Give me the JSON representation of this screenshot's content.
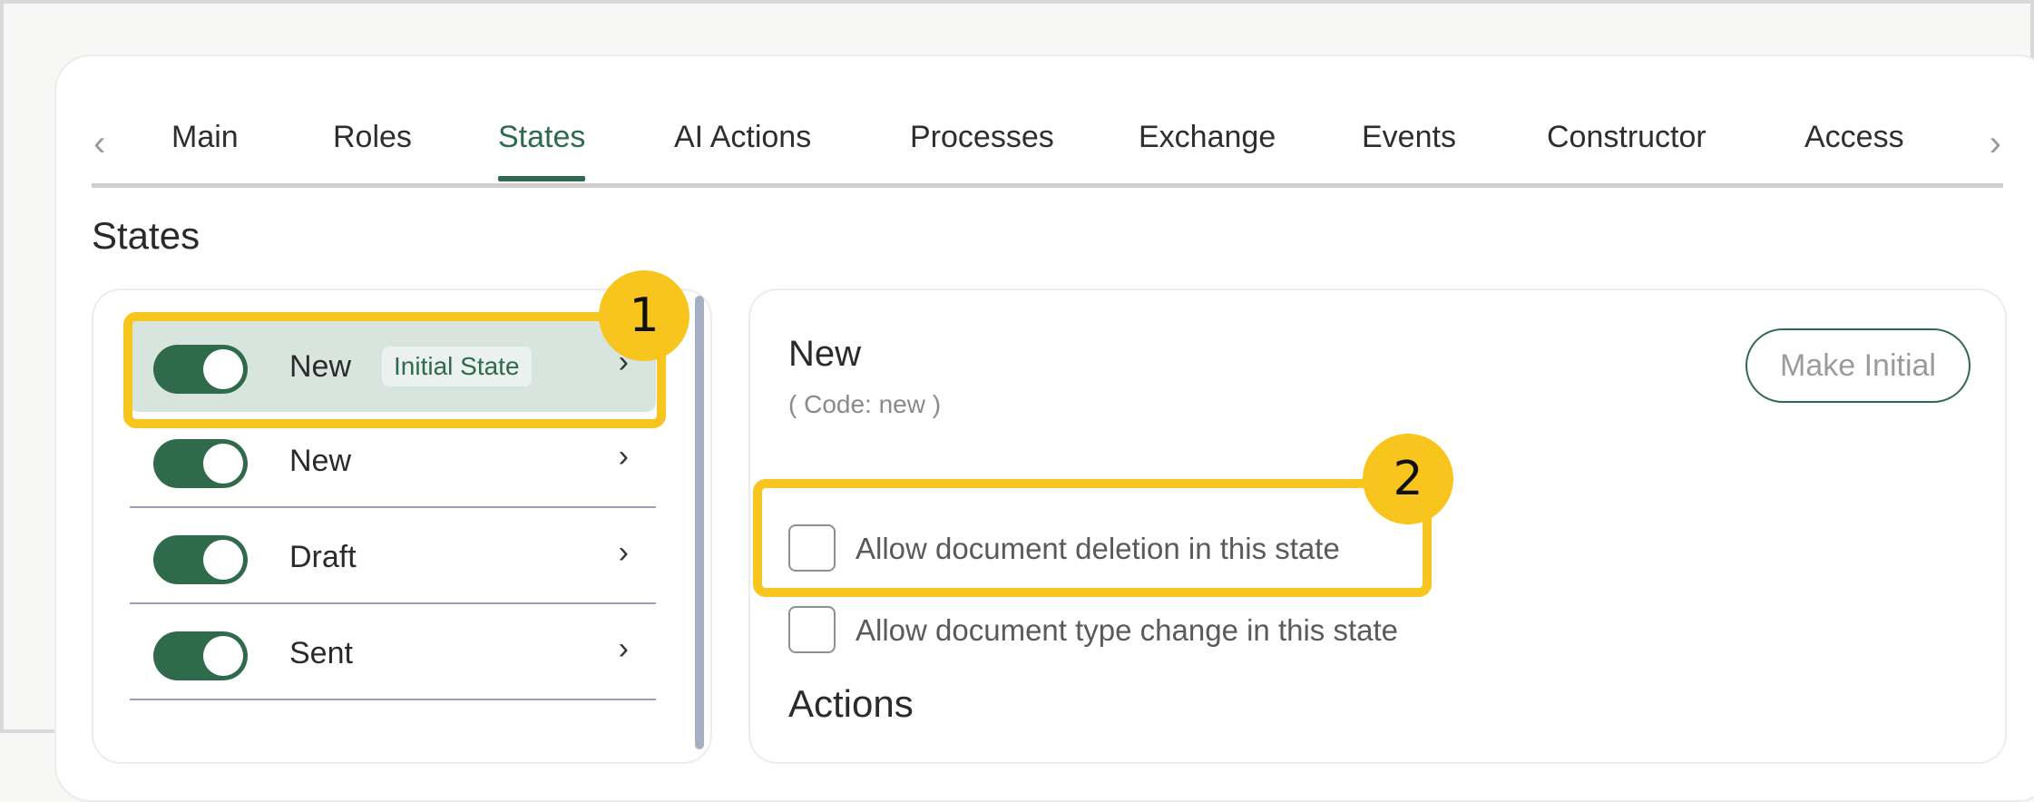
{
  "tabs": {
    "prev_icon": "chevron-left-icon",
    "next_icon": "chevron-right-icon",
    "items": [
      {
        "label": "Main"
      },
      {
        "label": "Roles"
      },
      {
        "label": "States",
        "active": true
      },
      {
        "label": "AI Actions"
      },
      {
        "label": "Processes"
      },
      {
        "label": "Exchange"
      },
      {
        "label": "Events"
      },
      {
        "label": "Constructor"
      },
      {
        "label": "Access"
      }
    ]
  },
  "section_title": "States",
  "states_list": {
    "items": [
      {
        "name": "New",
        "badge": "Initial State",
        "enabled": true,
        "selected": true
      },
      {
        "name": "New",
        "enabled": true
      },
      {
        "name": "Draft",
        "enabled": true
      },
      {
        "name": "Sent",
        "enabled": true
      }
    ]
  },
  "detail": {
    "title": "New",
    "code": "( Code: new )",
    "make_initial_label": "Make Initial",
    "options": [
      {
        "label": "Allow document deletion in this state",
        "checked": false
      },
      {
        "label": "Allow document type change in this state",
        "checked": false
      }
    ],
    "actions_heading": "Actions"
  },
  "annotations": {
    "markers": [
      "1",
      "2"
    ]
  },
  "colors": {
    "accent": "#2d6a4f",
    "toggle_on": "#2f6b4b",
    "selected_row": "#d8e5df",
    "highlight": "#f7c51e"
  }
}
